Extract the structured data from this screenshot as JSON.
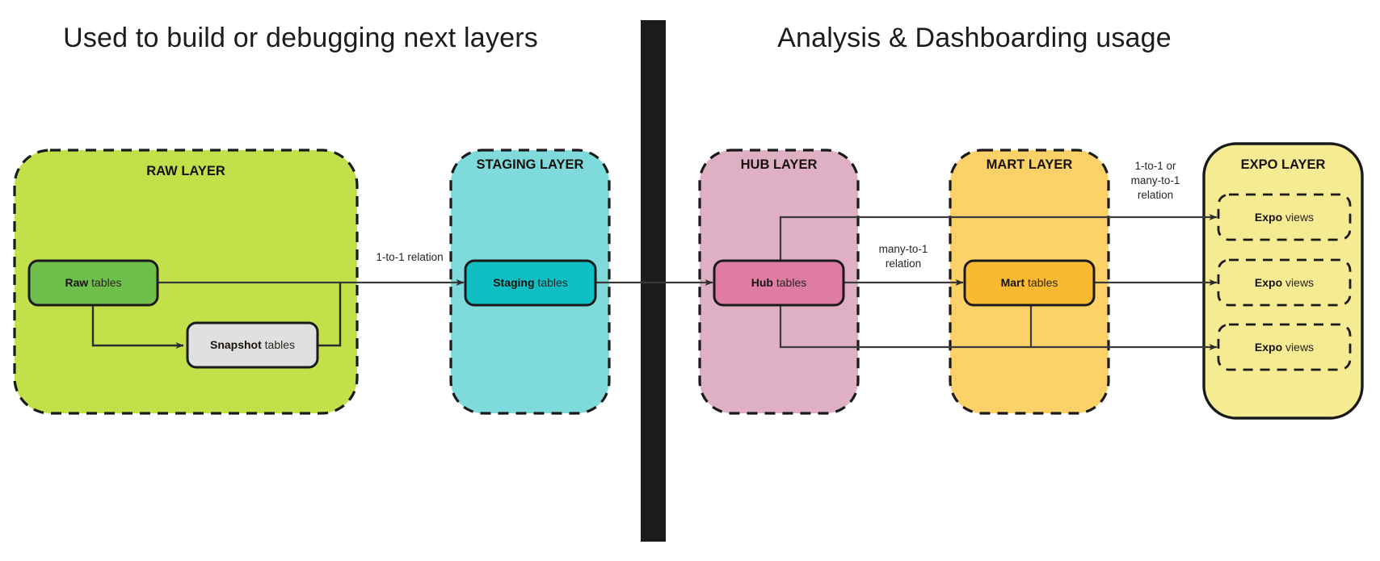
{
  "headings": {
    "left": "Used to build or debugging next layers",
    "right": "Analysis & Dashboarding usage"
  },
  "layers": [
    {
      "id": "raw",
      "title": "RAW LAYER",
      "fill": "#c2e04a",
      "border": "#1a1a1a",
      "border_style": "dashed"
    },
    {
      "id": "staging",
      "title": "STAGING LAYER",
      "fill": "#7fdbdb",
      "border": "#1a1a1a",
      "border_style": "dashed"
    },
    {
      "id": "hub",
      "title": "HUB LAYER",
      "fill": "#dfb0c4",
      "border": "#1a1a1a",
      "border_style": "dashed"
    },
    {
      "id": "mart",
      "title": "MART LAYER",
      "fill": "#fcd167",
      "border": "#1a1a1a",
      "border_style": "dashed"
    },
    {
      "id": "expo",
      "title": "EXPO LAYER",
      "fill": "#f5eb93",
      "border": "#1a1a1a",
      "border_style": "solid"
    }
  ],
  "nodes": {
    "raw_tables": {
      "strong": "Raw",
      "rest": " tables",
      "fill": "#6fbf4d"
    },
    "snapshot_tables": {
      "strong": "Snapshot",
      "rest": " tables",
      "fill": "#e0e0e0"
    },
    "staging_tables": {
      "strong": "Staging",
      "rest": " tables",
      "fill": "#0fbfc4"
    },
    "hub_tables": {
      "strong": "Hub",
      "rest": " tables",
      "fill": "#df7ca3"
    },
    "mart_tables": {
      "strong": "Mart",
      "rest": " tables",
      "fill": "#f9b931"
    },
    "expo_views_1": {
      "strong": "Expo",
      "rest": " views",
      "fill": "transparent"
    },
    "expo_views_2": {
      "strong": "Expo",
      "rest": " views",
      "fill": "transparent"
    },
    "expo_views_3": {
      "strong": "Expo",
      "rest": " views",
      "fill": "transparent"
    }
  },
  "edge_labels": {
    "raw_to_staging": "1-to-1 relation",
    "hub_to_mart": "many-to-1\nrelation",
    "mart_to_expo": "1-to-1 or\nmany-to-1\nrelation"
  },
  "divider": {
    "color": "#1c1c1c"
  },
  "colors": {
    "stroke": "#1a1a1a",
    "edge": "#3a3a3a",
    "text": "#17120d",
    "background": "#ffffff"
  }
}
